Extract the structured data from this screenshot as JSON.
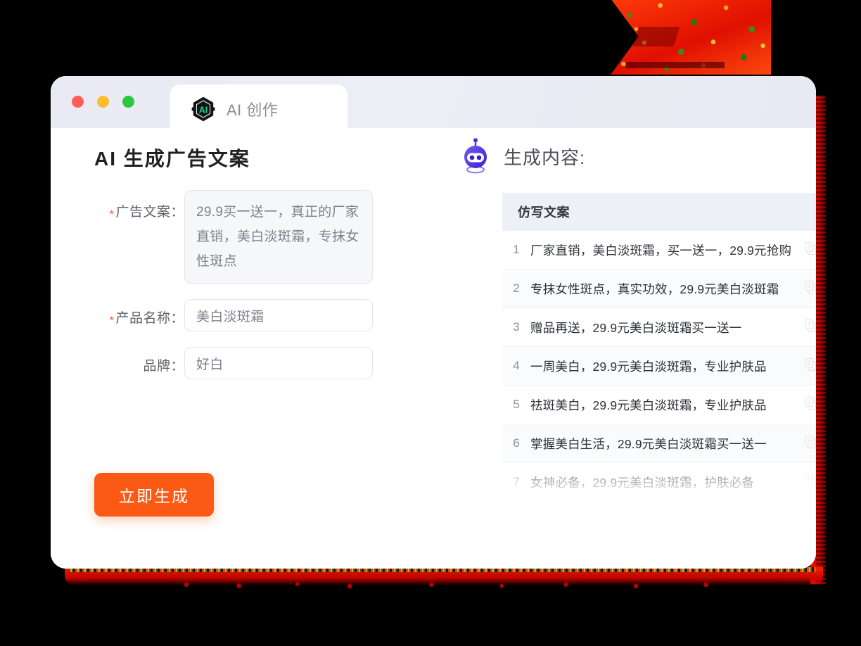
{
  "window": {
    "traffic_lights": [
      {
        "name": "close",
        "color": "#ff5d56"
      },
      {
        "name": "minimize",
        "color": "#febc2e"
      },
      {
        "name": "maximize",
        "color": "#2ac840"
      }
    ],
    "tab": {
      "label": "AI 创作",
      "logo_text": "AI",
      "logo_icon": "ai-hexagon-icon"
    }
  },
  "left": {
    "title": "AI 生成广告文案",
    "fields": [
      {
        "label": "广告文案：",
        "required": true,
        "type": "textarea",
        "value": "29.9买一送一，真正的厂家直销，美白淡斑霜，专抹女性斑点"
      },
      {
        "label": "产品名称：",
        "required": true,
        "type": "input",
        "value": "美白淡斑霜"
      },
      {
        "label": "品牌：",
        "required": false,
        "type": "input",
        "value": "好白"
      }
    ],
    "submit_button": "立即生成",
    "accent_color": "#fa5a14",
    "required_mark": "*"
  },
  "right": {
    "heading": "生成内容:",
    "robot_icon": "robot-head-icon",
    "table": {
      "column_header": "仿写文案",
      "rows": [
        {
          "index": "1",
          "text": "厂家直销，美白淡斑霜，买一送一，29.9元抢购"
        },
        {
          "index": "2",
          "text": "专抹女性斑点，真实功效，29.9元美白淡斑霜"
        },
        {
          "index": "3",
          "text": "赠品再送，29.9元美白淡斑霜买一送一"
        },
        {
          "index": "4",
          "text": "一周美白，29.9元美白淡斑霜，专业护肤品"
        },
        {
          "index": "5",
          "text": "祛斑美白，29.9元美白淡斑霜，专业护肤品"
        },
        {
          "index": "6",
          "text": "掌握美白生活，29.9元美白淡斑霜买一送一"
        },
        {
          "index": "7",
          "text": "女神必备，29.9元美白淡斑霜，护肤必备"
        }
      ],
      "copy_icon": "copy-icon"
    }
  }
}
